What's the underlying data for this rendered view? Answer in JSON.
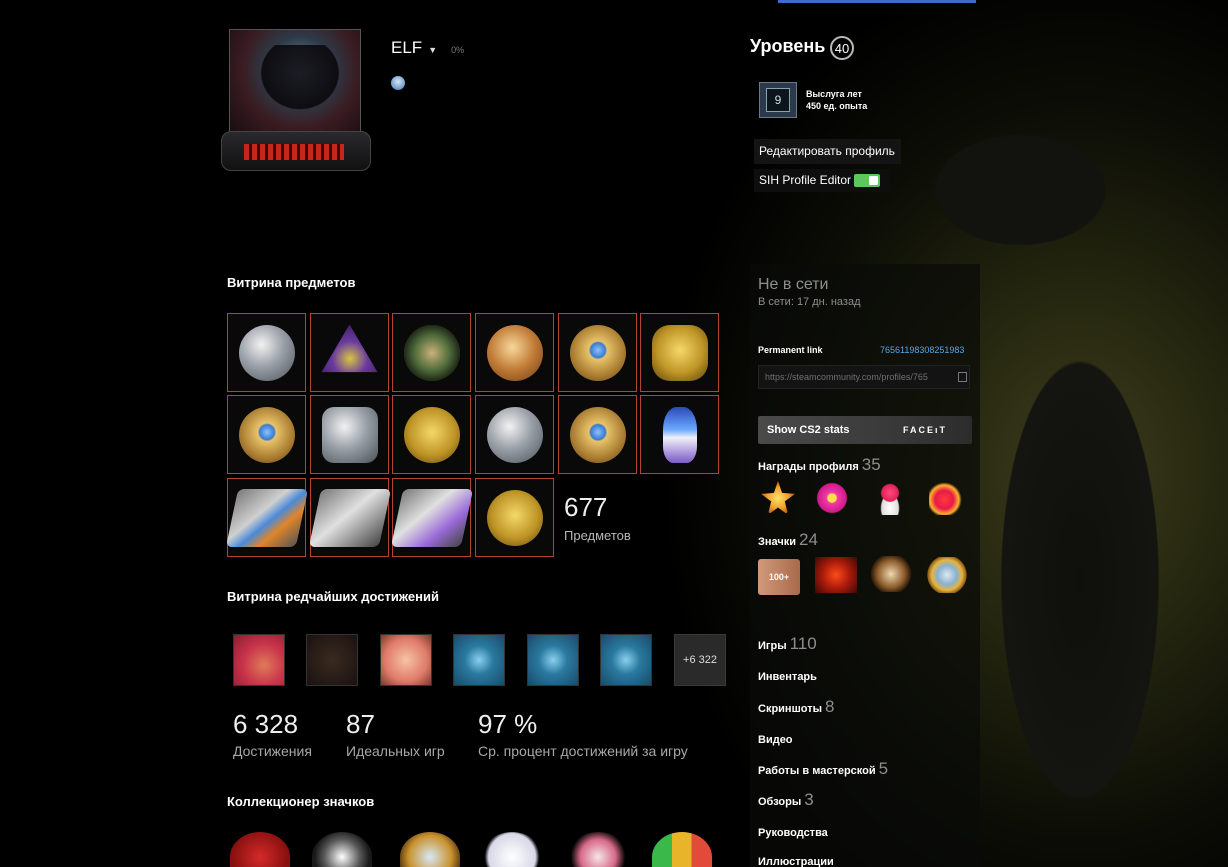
{
  "profile": {
    "name": "ELF",
    "caret": "▼",
    "xp_percent": "0%"
  },
  "level": {
    "title": "Уровень",
    "value": "40",
    "years_badge_num": "9",
    "years_title": "Выслуга лет",
    "years_xp": "450 ед. опыта"
  },
  "buttons": {
    "edit_profile": "Редактировать профиль",
    "sih_editor": "SIH Profile Editor",
    "sih_toggle": "on"
  },
  "status": {
    "state": "Не в сети",
    "last_online": "В сети: 17 дн. назад"
  },
  "permalink": {
    "label": "Permanent link",
    "id": "76561198308251983",
    "url": "https://steamcommunity.com/profiles/765"
  },
  "cs2": {
    "label": "Show CS2 stats",
    "faceit": "FACEıT"
  },
  "showcase": {
    "title": "Витрина предметов",
    "count": "677",
    "count_label": "Предметов",
    "items": [
      "service-medal-icon",
      "purple-pin-icon",
      "operation-coin-icon",
      "five-year-coin-icon",
      "gold-star-coin-icon",
      "tan-pin-icon",
      "star-pin-icon",
      "silver-shield-pin-icon",
      "gold-star-medal-icon",
      "silver-star-pin-icon",
      "blue-gold-coin-icon",
      "cupcake-pin-icon",
      "season-one-coin-icon",
      "season-two-coin-icon",
      "season-three-coin-icon",
      "gold-medal-icon"
    ]
  },
  "achievements": {
    "title": "Витрина редчайших достижений",
    "more": "+6 322",
    "total": "6 328",
    "total_label": "Достижения",
    "perfect": "87",
    "perfect_label": "Идеальных игр",
    "avg": "97 %",
    "avg_label": "Ср. процент достижений за игру"
  },
  "badge_collector": {
    "title": "Коллекционер значков"
  },
  "awards": {
    "title": "Награды профиля",
    "count": "35"
  },
  "badges": {
    "title": "Значки",
    "count": "24",
    "first_badge_text": "100+"
  },
  "links": {
    "games": "Игры",
    "games_count": "110",
    "inventory": "Инвентарь",
    "screenshots": "Скриншоты",
    "screenshots_count": "8",
    "video": "Видео",
    "workshop": "Работы в мастерской",
    "workshop_count": "5",
    "reviews": "Обзоры",
    "reviews_count": "3",
    "guides": "Руководства",
    "artwork": "Иллюстрации"
  },
  "colors": {
    "accent_blue": "#3e6cc8",
    "link_blue": "#58a6e6",
    "slot_border": "#b8412f",
    "toggle_green": "#5ec65e"
  }
}
